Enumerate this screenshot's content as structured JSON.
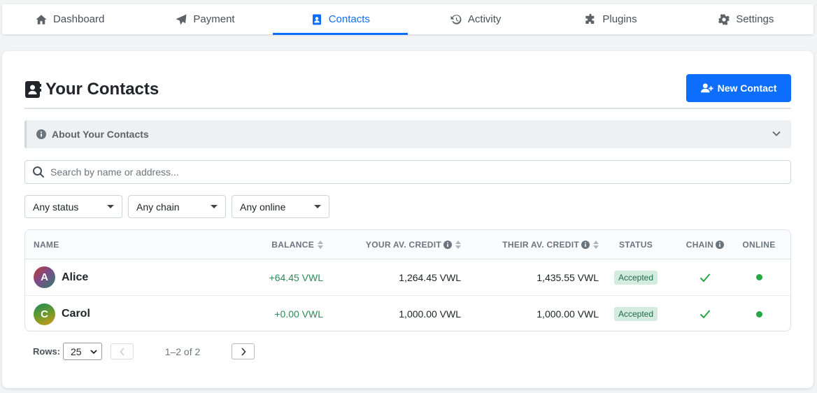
{
  "nav": {
    "tabs": [
      {
        "label": "Dashboard",
        "icon": "home-icon"
      },
      {
        "label": "Payment",
        "icon": "paper-plane-icon"
      },
      {
        "label": "Contacts",
        "icon": "address-book-icon",
        "active": true
      },
      {
        "label": "Activity",
        "icon": "history-icon"
      },
      {
        "label": "Plugins",
        "icon": "puzzle-icon"
      },
      {
        "label": "Settings",
        "icon": "gear-icon"
      }
    ]
  },
  "page": {
    "title": "Your Contacts",
    "new_contact_label": "New Contact"
  },
  "about": {
    "label": "About Your Contacts"
  },
  "search": {
    "placeholder": "Search by name or address..."
  },
  "filters": {
    "status": "Any status",
    "chain": "Any chain",
    "online": "Any online"
  },
  "table": {
    "headers": {
      "name": "NAME",
      "balance": "BALANCE",
      "your_credit": "YOUR AV. CREDIT",
      "their_credit": "THEIR AV. CREDIT",
      "status": "STATUS",
      "chain": "CHAIN",
      "online": "ONLINE"
    },
    "rows": [
      {
        "initial": "A",
        "name": "Alice",
        "balance": "+64.45 VWL",
        "your_credit": "1,264.45 VWL",
        "their_credit": "1,435.55 VWL",
        "status": "Accepted",
        "chain_ok": true,
        "online": true
      },
      {
        "initial": "C",
        "name": "Carol",
        "balance": "+0.00 VWL",
        "your_credit": "1,000.00 VWL",
        "their_credit": "1,000.00 VWL",
        "status": "Accepted",
        "chain_ok": true,
        "online": true
      }
    ]
  },
  "pager": {
    "rows_label": "Rows:",
    "rows_value": "25",
    "range": "1–2 of 2"
  },
  "colors": {
    "accent": "#0d6efd",
    "positive": "#2e8b57",
    "online": "#28a745"
  }
}
